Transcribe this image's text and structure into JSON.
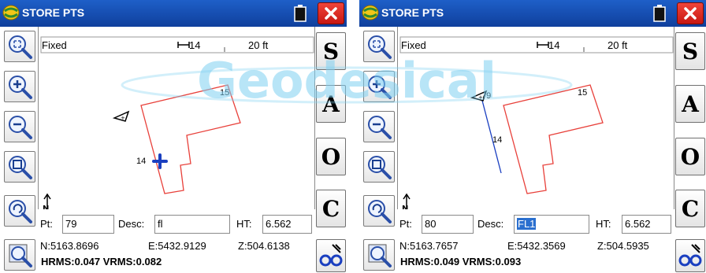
{
  "screens": [
    {
      "title": "STORE PTS",
      "mode": "Fixed",
      "distance": "14",
      "scale": "20 ft",
      "point_labels": [
        "15",
        "14"
      ],
      "side_buttons": [
        "S",
        "A",
        "O",
        "C"
      ],
      "pt_label": "Pt:",
      "pt_value": "79",
      "desc_label": "Desc:",
      "desc_value": "fl",
      "ht_label": "HT:",
      "ht_value": "6.562",
      "northing": "N:5163.8696",
      "easting": "E:5432.9129",
      "elevation": "Z:504.6138",
      "rms": "HRMS:0.047 VRMS:0.082"
    },
    {
      "title": "STORE PTS",
      "mode": "Fixed",
      "distance": "14",
      "scale": "20 ft",
      "point_labels": [
        "79",
        "15",
        "14"
      ],
      "side_buttons": [
        "S",
        "A",
        "O",
        "C"
      ],
      "pt_label": "Pt:",
      "pt_value": "80",
      "desc_label": "Desc:",
      "desc_value": "FL1",
      "ht_label": "HT:",
      "ht_value": "6.562",
      "northing": "N:5163.7657",
      "easting": "E:5432.3569",
      "elevation": "Z:504.5935",
      "rms": "HRMS:0.049 VRMS:0.093"
    }
  ],
  "watermark": "Geodesical",
  "colors": {
    "titlebar": "#1559c4",
    "close": "#e0261c",
    "boundary": "#e8403a",
    "rover": "#1a3fc0",
    "watermark": "#7fd0f2"
  },
  "icons": [
    "zoom-extents-icon",
    "zoom-in-icon",
    "zoom-out-icon",
    "zoom-window-icon",
    "zoom-previous-icon",
    "map-details-icon",
    "find-point-icon",
    "battery-icon",
    "close-icon",
    "north-arrow-icon",
    "app-logo-icon"
  ]
}
